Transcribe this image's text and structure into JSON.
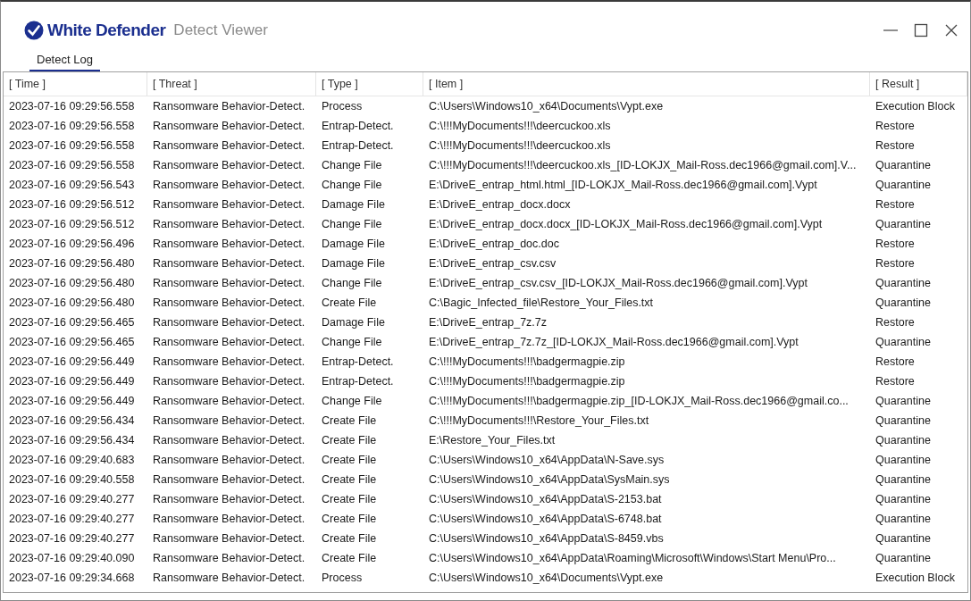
{
  "window": {
    "brand": "White Defender",
    "title": "Detect Viewer"
  },
  "tabs": [
    {
      "label": "Detect Log",
      "selected": true
    }
  ],
  "table": {
    "columns": [
      "[ Time ]",
      "[ Threat ]",
      "[ Type ]",
      "[ Item ]",
      "[ Result ]"
    ],
    "rows": [
      [
        "2023-07-16 09:29:56.558",
        "Ransomware Behavior-Detect.",
        "Process",
        "C:\\Users\\Windows10_x64\\Documents\\Vypt.exe",
        "Execution Block"
      ],
      [
        "2023-07-16 09:29:56.558",
        "Ransomware Behavior-Detect.",
        "Entrap-Detect.",
        "C:\\!!!MyDocuments!!!\\deercuckoo.xls",
        "Restore"
      ],
      [
        "2023-07-16 09:29:56.558",
        "Ransomware Behavior-Detect.",
        "Entrap-Detect.",
        "C:\\!!!MyDocuments!!!\\deercuckoo.xls",
        "Restore"
      ],
      [
        "2023-07-16 09:29:56.558",
        "Ransomware Behavior-Detect.",
        "Change File",
        "C:\\!!!MyDocuments!!!\\deercuckoo.xls_[ID-LOKJX_Mail-Ross.dec1966@gmail.com].V...",
        "Quarantine"
      ],
      [
        "2023-07-16 09:29:56.543",
        "Ransomware Behavior-Detect.",
        "Change File",
        "E:\\DriveE_entrap_html.html_[ID-LOKJX_Mail-Ross.dec1966@gmail.com].Vypt",
        "Quarantine"
      ],
      [
        "2023-07-16 09:29:56.512",
        "Ransomware Behavior-Detect.",
        "Damage File",
        "E:\\DriveE_entrap_docx.docx",
        "Restore"
      ],
      [
        "2023-07-16 09:29:56.512",
        "Ransomware Behavior-Detect.",
        "Change File",
        "E:\\DriveE_entrap_docx.docx_[ID-LOKJX_Mail-Ross.dec1966@gmail.com].Vypt",
        "Quarantine"
      ],
      [
        "2023-07-16 09:29:56.496",
        "Ransomware Behavior-Detect.",
        "Damage File",
        "E:\\DriveE_entrap_doc.doc",
        "Restore"
      ],
      [
        "2023-07-16 09:29:56.480",
        "Ransomware Behavior-Detect.",
        "Damage File",
        "E:\\DriveE_entrap_csv.csv",
        "Restore"
      ],
      [
        "2023-07-16 09:29:56.480",
        "Ransomware Behavior-Detect.",
        "Change File",
        "E:\\DriveE_entrap_csv.csv_[ID-LOKJX_Mail-Ross.dec1966@gmail.com].Vypt",
        "Quarantine"
      ],
      [
        "2023-07-16 09:29:56.480",
        "Ransomware Behavior-Detect.",
        "Create File",
        "C:\\Bagic_Infected_file\\Restore_Your_Files.txt",
        "Quarantine"
      ],
      [
        "2023-07-16 09:29:56.465",
        "Ransomware Behavior-Detect.",
        "Damage File",
        "E:\\DriveE_entrap_7z.7z",
        "Restore"
      ],
      [
        "2023-07-16 09:29:56.465",
        "Ransomware Behavior-Detect.",
        "Change File",
        "E:\\DriveE_entrap_7z.7z_[ID-LOKJX_Mail-Ross.dec1966@gmail.com].Vypt",
        "Quarantine"
      ],
      [
        "2023-07-16 09:29:56.449",
        "Ransomware Behavior-Detect.",
        "Entrap-Detect.",
        "C:\\!!!MyDocuments!!!\\badgermagpie.zip",
        "Restore"
      ],
      [
        "2023-07-16 09:29:56.449",
        "Ransomware Behavior-Detect.",
        "Entrap-Detect.",
        "C:\\!!!MyDocuments!!!\\badgermagpie.zip",
        "Restore"
      ],
      [
        "2023-07-16 09:29:56.449",
        "Ransomware Behavior-Detect.",
        "Change File",
        "C:\\!!!MyDocuments!!!\\badgermagpie.zip_[ID-LOKJX_Mail-Ross.dec1966@gmail.co...",
        "Quarantine"
      ],
      [
        "2023-07-16 09:29:56.434",
        "Ransomware Behavior-Detect.",
        "Create File",
        "C:\\!!!MyDocuments!!!\\Restore_Your_Files.txt",
        "Quarantine"
      ],
      [
        "2023-07-16 09:29:56.434",
        "Ransomware Behavior-Detect.",
        "Create File",
        "E:\\Restore_Your_Files.txt",
        "Quarantine"
      ],
      [
        "2023-07-16 09:29:40.683",
        "Ransomware Behavior-Detect.",
        "Create File",
        "C:\\Users\\Windows10_x64\\AppData\\N-Save.sys",
        "Quarantine"
      ],
      [
        "2023-07-16 09:29:40.558",
        "Ransomware Behavior-Detect.",
        "Create File",
        "C:\\Users\\Windows10_x64\\AppData\\SysMain.sys",
        "Quarantine"
      ],
      [
        "2023-07-16 09:29:40.277",
        "Ransomware Behavior-Detect.",
        "Create File",
        "C:\\Users\\Windows10_x64\\AppData\\S-2153.bat",
        "Quarantine"
      ],
      [
        "2023-07-16 09:29:40.277",
        "Ransomware Behavior-Detect.",
        "Create File",
        "C:\\Users\\Windows10_x64\\AppData\\S-6748.bat",
        "Quarantine"
      ],
      [
        "2023-07-16 09:29:40.277",
        "Ransomware Behavior-Detect.",
        "Create File",
        "C:\\Users\\Windows10_x64\\AppData\\S-8459.vbs",
        "Quarantine"
      ],
      [
        "2023-07-16 09:29:40.090",
        "Ransomware Behavior-Detect.",
        "Create File",
        "C:\\Users\\Windows10_x64\\AppData\\Roaming\\Microsoft\\Windows\\Start Menu\\Pro...",
        "Quarantine"
      ],
      [
        "2023-07-16 09:29:34.668",
        "Ransomware Behavior-Detect.",
        "Process",
        "C:\\Users\\Windows10_x64\\Documents\\Vypt.exe",
        "Execution Block"
      ]
    ]
  }
}
